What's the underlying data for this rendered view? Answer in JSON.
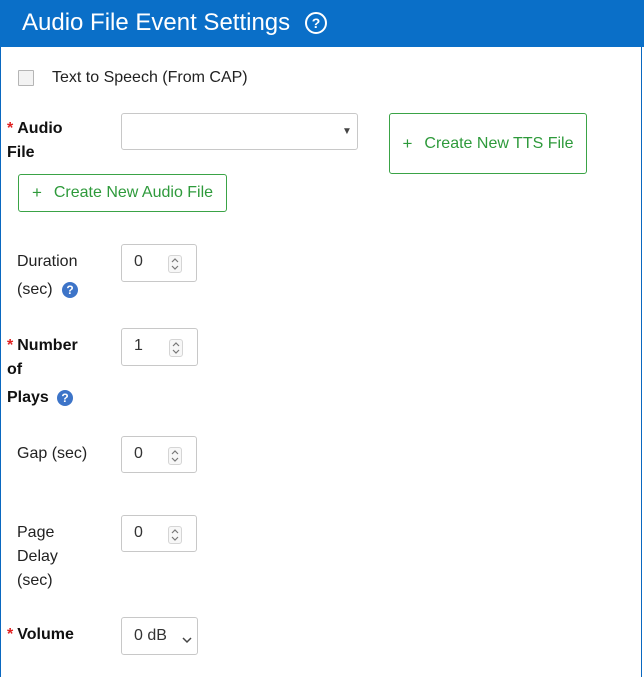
{
  "header": {
    "title": "Audio File Event Settings",
    "help_glyph": "?"
  },
  "tts": {
    "label": "Text to Speech (From CAP)",
    "checked": false
  },
  "audio_file": {
    "required_mark": "*",
    "label_line1": "Audio",
    "label_line2": "File",
    "selected_value": "",
    "create_tts_label": "Create New TTS File",
    "create_audio_label": "Create New Audio File",
    "plus_glyph": "+"
  },
  "duration": {
    "label_line1": "Duration",
    "label_line2": "(sec)",
    "value": "0"
  },
  "plays": {
    "required_mark": "*",
    "label_line1": "Number",
    "label_line2": "of",
    "label_line3": "Plays",
    "value": "1"
  },
  "gap": {
    "label": "Gap (sec)",
    "value": "0"
  },
  "page_delay": {
    "label_line1": "Page",
    "label_line2": "Delay",
    "label_line3": "(sec)",
    "value": "0"
  },
  "volume": {
    "required_mark": "*",
    "label": "Volume",
    "selected_value": "0 dB"
  },
  "help_glyph": "?"
}
